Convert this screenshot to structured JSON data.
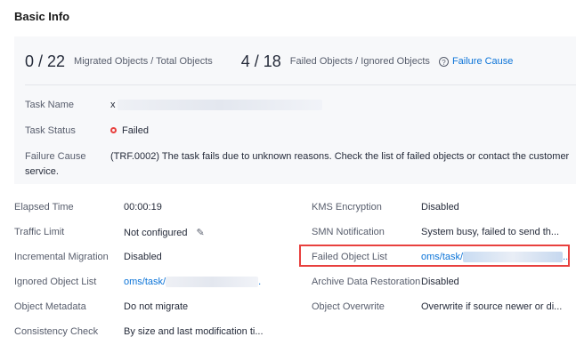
{
  "title": "Basic Info",
  "stats": {
    "migrated_value": "0 / 22",
    "migrated_label": "Migrated Objects / Total Objects",
    "failed_value": "4 / 18",
    "failed_label": "Failed Objects / Ignored Objects",
    "failure_link": "Failure Cause"
  },
  "task": {
    "name_label": "Task Name",
    "name_value": "x",
    "status_label": "Task Status",
    "status_value": "Failed",
    "cause_label": "Failure Cause",
    "cause_value": "(TRF.0002) The task fails due to unknown reasons. Check the list of failed objects or contact the customer",
    "cause_value_2": "service."
  },
  "details": {
    "left": [
      {
        "label": "Elapsed Time",
        "value": "00:00:19"
      },
      {
        "label": "Traffic Limit",
        "value": "Not configured"
      },
      {
        "label": "Incremental Migration",
        "value": "Disabled"
      },
      {
        "label": "Ignored Object List",
        "value": "oms/task/"
      },
      {
        "label": "Object Metadata",
        "value": "Do not migrate"
      },
      {
        "label": "Consistency Check",
        "value": "By size and last modification ti..."
      }
    ],
    "right": [
      {
        "label": "KMS Encryption",
        "value": "Disabled"
      },
      {
        "label": "SMN Notification",
        "value": "System busy, failed to send th..."
      },
      {
        "label": "Failed Object List",
        "value": "oms/task/"
      },
      {
        "label": "Archive Data Restoration",
        "value": "Disabled"
      },
      {
        "label": "Object Overwrite",
        "value": "Overwrite if source newer or di..."
      }
    ]
  },
  "colors": {
    "link": "#0c74d8",
    "error": "#e8403e",
    "panel": "#f7f8fa"
  }
}
